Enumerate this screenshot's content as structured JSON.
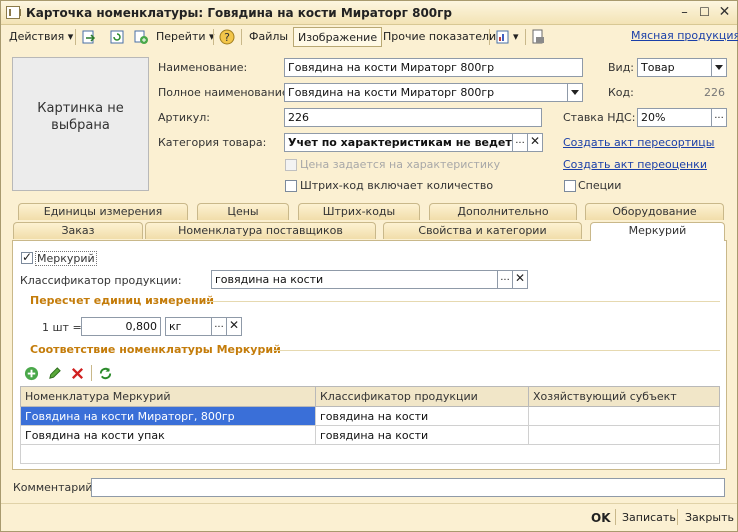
{
  "window": {
    "title": "Карточка номенклатуры: Говядина на кости Мираторг 800гр"
  },
  "toolbar": {
    "actions_label": "Действия",
    "goto_label": "Перейти",
    "files_label": "Файлы",
    "image_label": "Изображение",
    "other_label": "Прочие показатели",
    "link_label": "Мясная продукция"
  },
  "picture": {
    "placeholder": "Картинка не выбрана"
  },
  "form": {
    "name_label": "Наименование:",
    "name_value": "Говядина на кости Мираторг 800гр",
    "fullname_label": "Полное наименование:",
    "fullname_value": "Говядина на кости Мираторг 800гр",
    "article_label": "Артикул:",
    "article_value": "226",
    "category_label": "Категория товара:",
    "category_value": "Учет по характеристикам не ведется",
    "price_by_char_label": "Цена задается на характеристику",
    "barcode_qty_label": "Штрих-код включает количество",
    "kind_label": "Вид:",
    "kind_value": "Товар",
    "code_label": "Код:",
    "code_value": "226",
    "vat_label": "Ставка НДС:",
    "vat_value": "20%",
    "link_resort": "Создать акт пересортицы",
    "link_reprice": "Создать акт переоценки",
    "spices_label": "Специи"
  },
  "tabs_row1": [
    "Единицы измерения",
    "Цены",
    "Штрих-коды",
    "Дополнительно",
    "Оборудование"
  ],
  "tabs_row2": [
    "Заказ",
    "Номенклатура поставщиков",
    "Свойства и категории",
    "Меркурий"
  ],
  "mercury": {
    "checkbox_label": "Меркурий",
    "classifier_label": "Классификатор продукции:",
    "classifier_value": "говядина на кости",
    "recalc_title": "Пересчет единиц измерений",
    "unit_label": "1 шт =",
    "unit_value": "0,800",
    "unit_name": "кг",
    "match_title": "Соответствие номенклатуры Меркурий"
  },
  "grid": {
    "columns": [
      "Номенклатура Меркурий",
      "Классификатор продукции",
      "Хозяйствующий субъект"
    ],
    "rows": [
      [
        "Говядина на кости Мираторг, 800гр",
        "говядина на кости",
        ""
      ],
      [
        "Говядина на кости упак",
        "говядина на кости",
        ""
      ]
    ]
  },
  "comment_label": "Комментарий:",
  "buttons": {
    "ok": "OK",
    "save": "Записать",
    "close": "Закрыть"
  }
}
